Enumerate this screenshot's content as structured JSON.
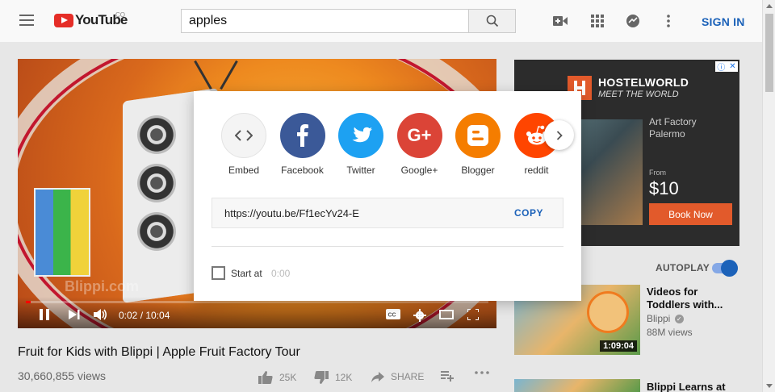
{
  "header": {
    "logo_text": "YouTube",
    "region": "CO",
    "search_value": "apples",
    "sign_in": "SIGN IN",
    "icons": [
      "menu-icon",
      "search-icon",
      "video-camera-icon",
      "apps-grid-icon",
      "messages-icon",
      "more-vert-icon"
    ]
  },
  "player": {
    "time": "0:02 / 10:04",
    "progress": 0.003,
    "watermark": "Blippi.com"
  },
  "video": {
    "title": "Fruit for Kids with Blippi | Apple Fruit Factory Tour",
    "views": "30,660,855 views",
    "likes": "25K",
    "dislikes": "12K",
    "share": "SHARE"
  },
  "share_dialog": {
    "targets": [
      {
        "label": "Embed",
        "color": "#f4f4f4",
        "icon": "embed-icon"
      },
      {
        "label": "Facebook",
        "color": "#3b5998",
        "icon": "facebook-icon"
      },
      {
        "label": "Twitter",
        "color": "#1da1f2",
        "icon": "twitter-icon"
      },
      {
        "label": "Google+",
        "color": "#db4437",
        "icon": "google-plus-icon"
      },
      {
        "label": "Blogger",
        "color": "#f57d00",
        "icon": "blogger-icon"
      },
      {
        "label": "reddit",
        "color": "#ff4500",
        "icon": "reddit-icon"
      }
    ],
    "url": "https://youtu.be/Ff1ecYv24-E",
    "copy": "COPY",
    "start_at_label": "Start at",
    "start_at_time": "0:00",
    "start_at_checked": false
  },
  "ad": {
    "brand": "HOSTELWORLD",
    "tagline": "MEET THE WORLD",
    "location_line1": "Art Factory",
    "location_line2": "Palermo",
    "from": "From",
    "price": "$10",
    "cta": "Book Now"
  },
  "sidebar": {
    "autoplay": "AUTOPLAY",
    "autoplay_on": true,
    "related": [
      {
        "title": "Videos for Toddlers with...",
        "channel": "Blippi",
        "views": "88M views",
        "duration": "1:09:04"
      },
      {
        "title": "Blippi Learns at",
        "channel": "",
        "views": "",
        "duration": ""
      }
    ]
  }
}
